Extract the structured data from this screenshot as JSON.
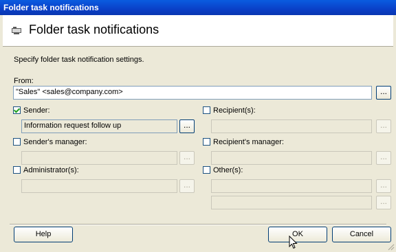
{
  "window": {
    "title": "Folder task notifications"
  },
  "header": {
    "title": "Folder task notifications",
    "icon": "folder-task-icon"
  },
  "description": "Specify folder task notification settings.",
  "from": {
    "label": "From:",
    "value": "\"Sales\" <sales@company.com>",
    "browse_label": "..."
  },
  "sender": {
    "label": "Sender:",
    "checked": true,
    "value": "Information request follow up",
    "browse_label": "..."
  },
  "senders_manager": {
    "label": "Sender's manager:",
    "checked": false,
    "value": "",
    "browse_label": "..."
  },
  "administrators": {
    "label": "Administrator(s):",
    "checked": false,
    "value": "",
    "browse_label": "..."
  },
  "recipients": {
    "label": "Recipient(s):",
    "checked": false,
    "value": "",
    "browse_label": "..."
  },
  "recipients_manager": {
    "label": "Recipient's manager:",
    "checked": false,
    "value": "",
    "browse_label": "..."
  },
  "others": {
    "label": "Other(s):",
    "checked": false,
    "value1": "",
    "value2": "",
    "browse_label": "..."
  },
  "buttons": {
    "help": "Help",
    "ok": "OK",
    "cancel": "Cancel"
  }
}
